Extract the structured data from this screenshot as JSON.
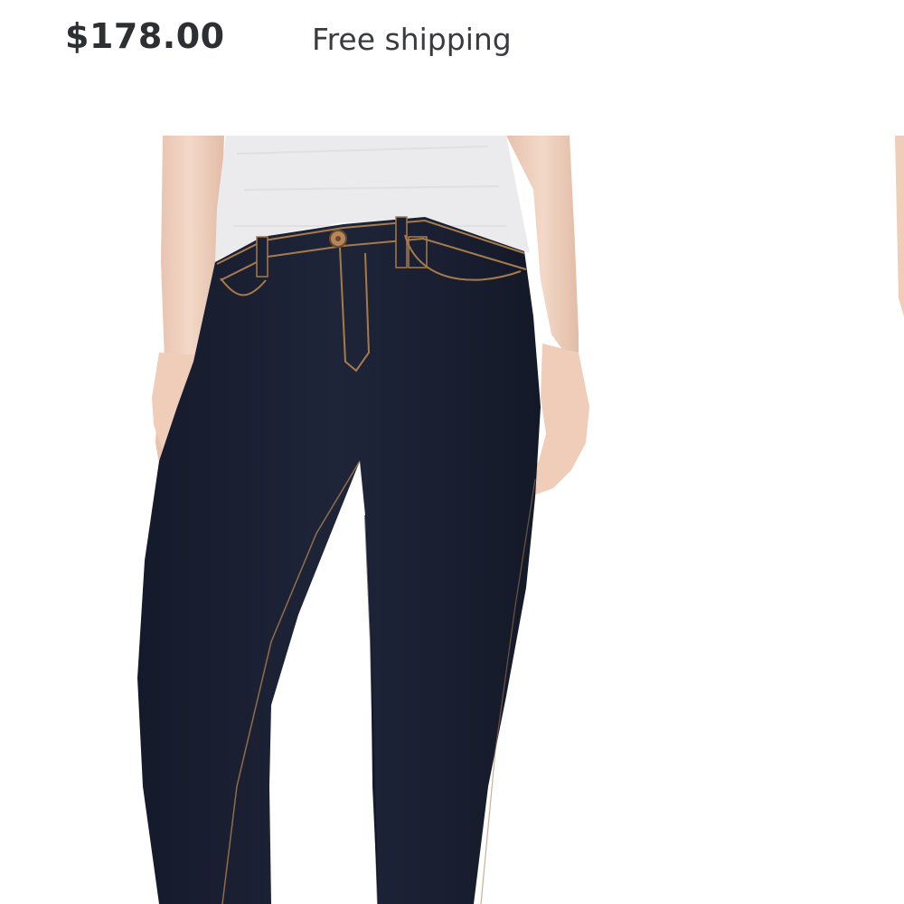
{
  "listing": {
    "price": "$178.00",
    "shipping": "Free shipping"
  },
  "photo": {
    "subject": "dark-wash skinny jeans with white t-shirt",
    "colors": {
      "denim": "#1b2033",
      "shirt": "#ececee",
      "skin": "#f1d3c2",
      "stitch": "#a67b4c"
    }
  }
}
